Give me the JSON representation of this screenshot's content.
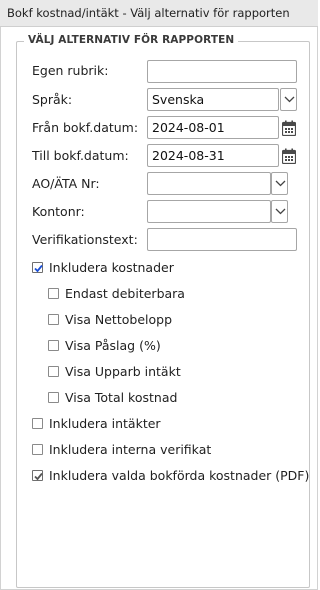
{
  "window": {
    "title": "Bokf kostnad/intäkt - Välj alternativ för rapporten"
  },
  "group": {
    "legend": "VÄLJ ALTERNATIV FÖR RAPPORTEN"
  },
  "fields": {
    "rubrik": {
      "label": "Egen rubrik:",
      "value": ""
    },
    "sprak": {
      "label": "Språk:",
      "value": "Svenska"
    },
    "fran": {
      "label": "Från bokf.datum:",
      "value": "2024-08-01"
    },
    "till": {
      "label": "Till bokf.datum:",
      "value": "2024-08-31"
    },
    "ao": {
      "label": "AO/ÄTA Nr:",
      "value": ""
    },
    "konto": {
      "label": "Kontonr:",
      "value": ""
    },
    "verif": {
      "label": "Verifikationstext:",
      "value": ""
    }
  },
  "checkboxes": {
    "kostnader": {
      "label": "Inkludera kostnader",
      "checked": true
    },
    "debiterbara": {
      "label": "Endast debiterbara",
      "checked": false
    },
    "netto": {
      "label": "Visa Nettobelopp",
      "checked": false
    },
    "paslag": {
      "label": "Visa Påslag (%)",
      "checked": false
    },
    "upparb": {
      "label": "Visa Upparb intäkt",
      "checked": false
    },
    "total": {
      "label": "Visa Total kostnad",
      "checked": false
    },
    "intakter": {
      "label": "Inkludera intäkter",
      "checked": false
    },
    "interna": {
      "label": "Inkludera interna verifikat",
      "checked": false
    },
    "pdf": {
      "label": "Inkludera valda bokförda kostnader (PDF)",
      "checked": true
    }
  },
  "colors": {
    "check": "#1b4fd6",
    "check_pdf": "#555555"
  },
  "icons": {
    "calendar": "calendar-icon",
    "dropdown": "chevron-down-icon",
    "check": "checkmark-icon"
  }
}
